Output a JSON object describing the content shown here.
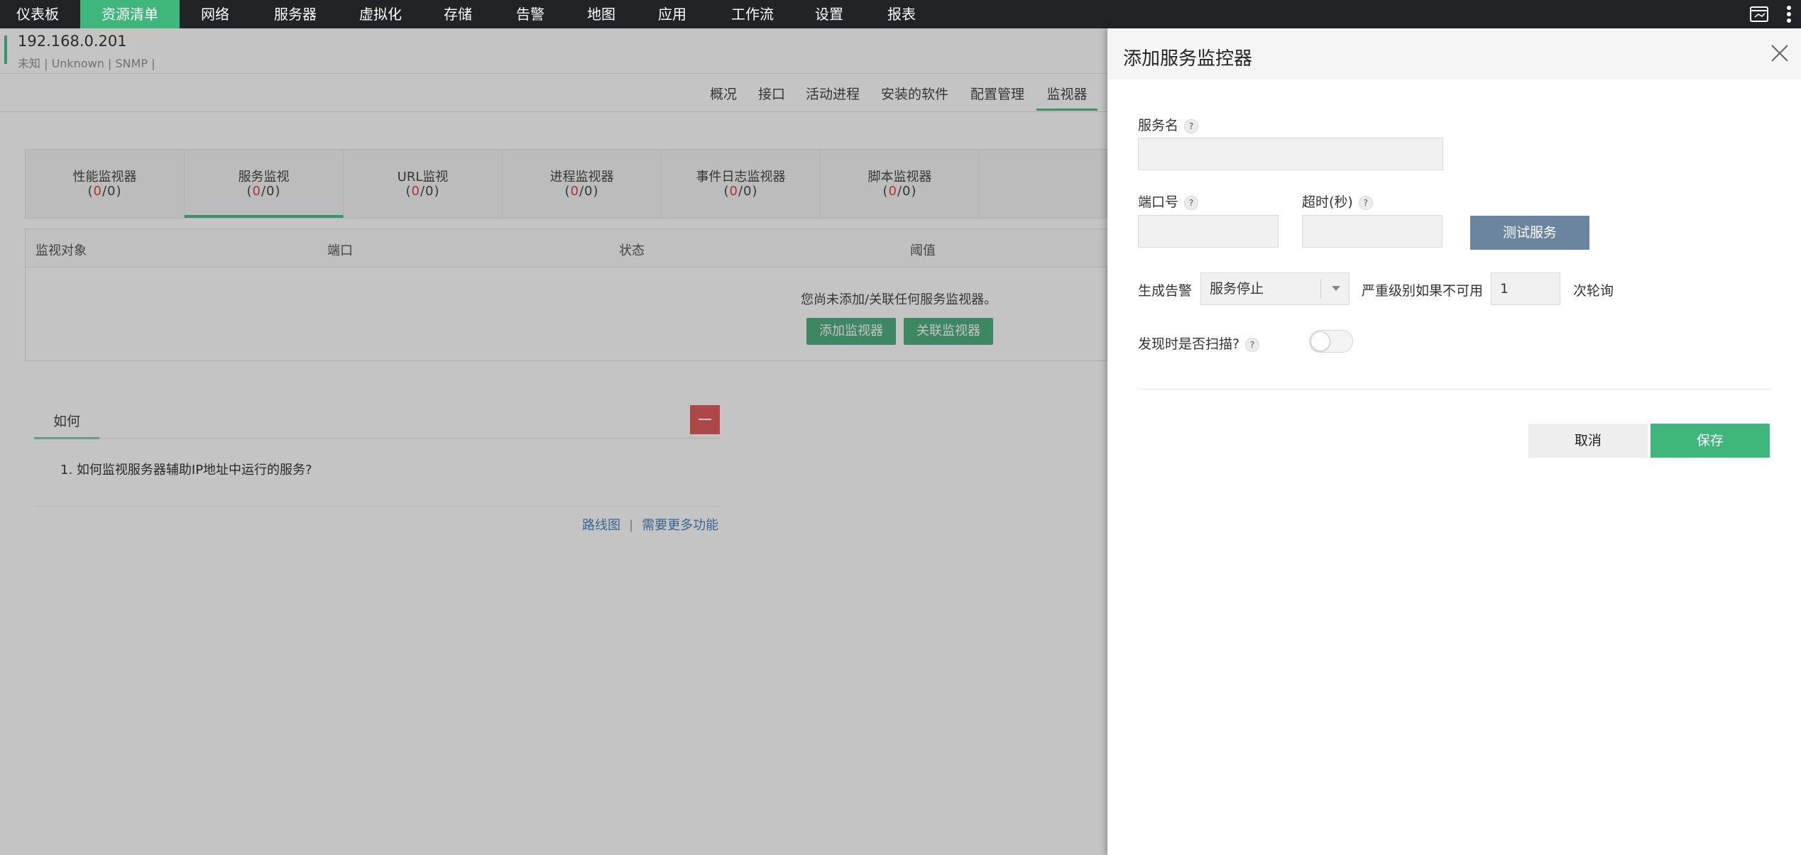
{
  "topnav": {
    "items": [
      "仪表板",
      "资源清单",
      "网络",
      "服务器",
      "虚拟化",
      "存储",
      "告警",
      "地图",
      "应用",
      "工作流",
      "设置",
      "报表"
    ],
    "active_index": 1
  },
  "device": {
    "ip": "192.168.0.201",
    "meta": "未知 | Unknown | SNMP |"
  },
  "subtabs": [
    "概况",
    "接口",
    "活动进程",
    "安装的软件",
    "配置管理",
    "监视器"
  ],
  "monitor_tabs": [
    {
      "name": "性能监视器",
      "count_a": "0",
      "count_b": "0"
    },
    {
      "name": "服务监视",
      "count_a": "0",
      "count_b": "0"
    },
    {
      "name": "URL监视",
      "count_a": "0",
      "count_b": "0"
    },
    {
      "name": "进程监视器",
      "count_a": "0",
      "count_b": "0"
    },
    {
      "name": "事件日志监视器",
      "count_a": "0",
      "count_b": "0"
    },
    {
      "name": "脚本监视器",
      "count_a": "0",
      "count_b": "0"
    }
  ],
  "grid": {
    "columns": [
      "监视对象",
      "端口",
      "状态",
      "阈值"
    ],
    "empty_message": "您尚未添加/关联任何服务监视器。",
    "add_button": "添加监视器",
    "associate_button": "关联监视器"
  },
  "howto": {
    "tab": "如何",
    "items": [
      "1. 如何监视服务器辅助IP地址中运行的服务?"
    ]
  },
  "footer": {
    "roadmap": "路线图",
    "separator": "|",
    "more_features": "需要更多功能"
  },
  "panel": {
    "title": "添加服务监控器",
    "service_name_label": "服务名",
    "service_name_value": "",
    "port_label": "端口号",
    "port_value": "",
    "timeout_label": "超时(秒)",
    "timeout_value": "",
    "test_button": "测试服务",
    "alarm_label": "生成告警",
    "alarm_select_value": "服务停止",
    "severity_label": "严重级别如果不可用",
    "poll_value": "1",
    "poll_suffix": "次轮询",
    "scan_label": "发现时是否扫描?",
    "scan_enabled": false,
    "help_glyph": "?",
    "cancel_button": "取消",
    "save_button": "保存"
  },
  "colors": {
    "nav_bg": "#222326",
    "accent_green": "#3fb67c",
    "test_button": "#6b84a0",
    "collapse_red": "#e04c4c",
    "count_red": "#e03030"
  }
}
